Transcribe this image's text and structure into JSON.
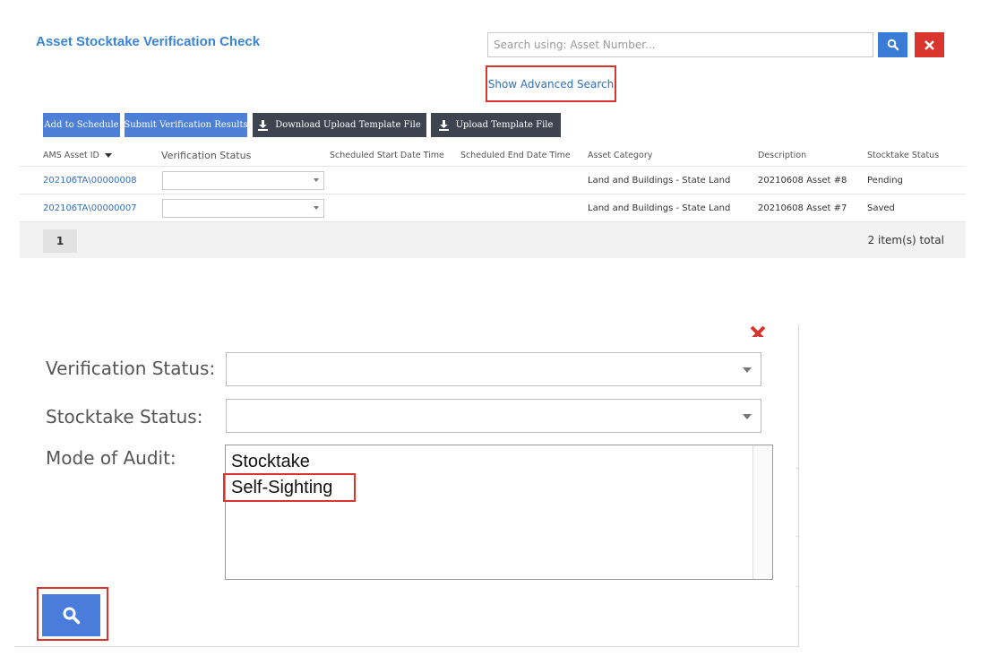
{
  "header": {
    "title": "Asset Stocktake Verification Check",
    "search_placeholder": "Search using: Asset Number...",
    "advanced_search_link": "Show Advanced Search"
  },
  "toolbar": {
    "add_to_schedule": "Add to Schedule",
    "submit_verification_results": "Submit Verification Results",
    "download_upload_template": "Download Upload Template File",
    "upload_template": "Upload Template File"
  },
  "grid": {
    "columns": [
      "AMS Asset ID",
      "Verification Status",
      "Scheduled Start Date Time",
      "Scheduled End Date Time",
      "Asset Category",
      "Description",
      "Stocktake Status"
    ],
    "rows": [
      {
        "asset_id": "202106TA\\00000008",
        "verification_status": "",
        "scheduled_start": "",
        "scheduled_end": "",
        "asset_category": "Land and Buildings - State Land",
        "description": "20210608 Asset #8",
        "stocktake_status": "Pending"
      },
      {
        "asset_id": "202106TA\\00000007",
        "verification_status": "",
        "scheduled_start": "",
        "scheduled_end": "",
        "asset_category": "Land and Buildings - State Land",
        "description": "20210608 Asset #7",
        "stocktake_status": "Saved"
      }
    ],
    "current_page": "1",
    "total": "2 item(s) total"
  },
  "advanced_search": {
    "verification_status_label": "Verification Status:",
    "verification_status_value": "",
    "stocktake_status_label": "Stocktake Status:",
    "stocktake_status_value": "",
    "mode_of_audit_label": "Mode of Audit:",
    "mode_options": [
      "Stocktake",
      "Self-Sighting"
    ]
  },
  "icons": {
    "search": "search-icon",
    "close": "close-icon",
    "download": "download-icon",
    "upload": "upload-icon",
    "sort": "sort-down-icon"
  },
  "colors": {
    "title_blue": "#3a84d8",
    "link_blue": "#2f6fc0",
    "primary_button": "#4d7fd6",
    "dark_button": "#3d4450",
    "danger_red": "#d9352c",
    "highlight_box": "#d9352c"
  }
}
